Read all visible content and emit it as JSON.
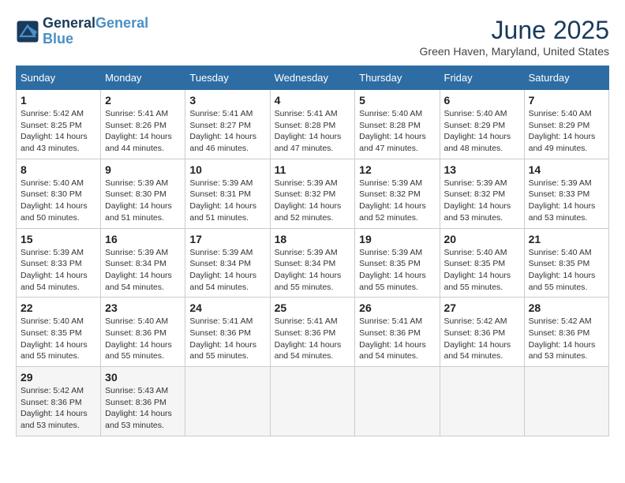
{
  "header": {
    "logo_line1": "General",
    "logo_line2": "Blue",
    "month_year": "June 2025",
    "location": "Green Haven, Maryland, United States"
  },
  "weekdays": [
    "Sunday",
    "Monday",
    "Tuesday",
    "Wednesday",
    "Thursday",
    "Friday",
    "Saturday"
  ],
  "weeks": [
    [
      {
        "day": "1",
        "sunrise": "5:42 AM",
        "sunset": "8:25 PM",
        "daylight": "14 hours and 43 minutes."
      },
      {
        "day": "2",
        "sunrise": "5:41 AM",
        "sunset": "8:26 PM",
        "daylight": "14 hours and 44 minutes."
      },
      {
        "day": "3",
        "sunrise": "5:41 AM",
        "sunset": "8:27 PM",
        "daylight": "14 hours and 46 minutes."
      },
      {
        "day": "4",
        "sunrise": "5:41 AM",
        "sunset": "8:28 PM",
        "daylight": "14 hours and 47 minutes."
      },
      {
        "day": "5",
        "sunrise": "5:40 AM",
        "sunset": "8:28 PM",
        "daylight": "14 hours and 47 minutes."
      },
      {
        "day": "6",
        "sunrise": "5:40 AM",
        "sunset": "8:29 PM",
        "daylight": "14 hours and 48 minutes."
      },
      {
        "day": "7",
        "sunrise": "5:40 AM",
        "sunset": "8:29 PM",
        "daylight": "14 hours and 49 minutes."
      }
    ],
    [
      {
        "day": "8",
        "sunrise": "5:40 AM",
        "sunset": "8:30 PM",
        "daylight": "14 hours and 50 minutes."
      },
      {
        "day": "9",
        "sunrise": "5:39 AM",
        "sunset": "8:30 PM",
        "daylight": "14 hours and 51 minutes."
      },
      {
        "day": "10",
        "sunrise": "5:39 AM",
        "sunset": "8:31 PM",
        "daylight": "14 hours and 51 minutes."
      },
      {
        "day": "11",
        "sunrise": "5:39 AM",
        "sunset": "8:32 PM",
        "daylight": "14 hours and 52 minutes."
      },
      {
        "day": "12",
        "sunrise": "5:39 AM",
        "sunset": "8:32 PM",
        "daylight": "14 hours and 52 minutes."
      },
      {
        "day": "13",
        "sunrise": "5:39 AM",
        "sunset": "8:32 PM",
        "daylight": "14 hours and 53 minutes."
      },
      {
        "day": "14",
        "sunrise": "5:39 AM",
        "sunset": "8:33 PM",
        "daylight": "14 hours and 53 minutes."
      }
    ],
    [
      {
        "day": "15",
        "sunrise": "5:39 AM",
        "sunset": "8:33 PM",
        "daylight": "14 hours and 54 minutes."
      },
      {
        "day": "16",
        "sunrise": "5:39 AM",
        "sunset": "8:34 PM",
        "daylight": "14 hours and 54 minutes."
      },
      {
        "day": "17",
        "sunrise": "5:39 AM",
        "sunset": "8:34 PM",
        "daylight": "14 hours and 54 minutes."
      },
      {
        "day": "18",
        "sunrise": "5:39 AM",
        "sunset": "8:34 PM",
        "daylight": "14 hours and 55 minutes."
      },
      {
        "day": "19",
        "sunrise": "5:39 AM",
        "sunset": "8:35 PM",
        "daylight": "14 hours and 55 minutes."
      },
      {
        "day": "20",
        "sunrise": "5:40 AM",
        "sunset": "8:35 PM",
        "daylight": "14 hours and 55 minutes."
      },
      {
        "day": "21",
        "sunrise": "5:40 AM",
        "sunset": "8:35 PM",
        "daylight": "14 hours and 55 minutes."
      }
    ],
    [
      {
        "day": "22",
        "sunrise": "5:40 AM",
        "sunset": "8:35 PM",
        "daylight": "14 hours and 55 minutes."
      },
      {
        "day": "23",
        "sunrise": "5:40 AM",
        "sunset": "8:36 PM",
        "daylight": "14 hours and 55 minutes."
      },
      {
        "day": "24",
        "sunrise": "5:41 AM",
        "sunset": "8:36 PM",
        "daylight": "14 hours and 55 minutes."
      },
      {
        "day": "25",
        "sunrise": "5:41 AM",
        "sunset": "8:36 PM",
        "daylight": "14 hours and 54 minutes."
      },
      {
        "day": "26",
        "sunrise": "5:41 AM",
        "sunset": "8:36 PM",
        "daylight": "14 hours and 54 minutes."
      },
      {
        "day": "27",
        "sunrise": "5:42 AM",
        "sunset": "8:36 PM",
        "daylight": "14 hours and 54 minutes."
      },
      {
        "day": "28",
        "sunrise": "5:42 AM",
        "sunset": "8:36 PM",
        "daylight": "14 hours and 53 minutes."
      }
    ],
    [
      {
        "day": "29",
        "sunrise": "5:42 AM",
        "sunset": "8:36 PM",
        "daylight": "14 hours and 53 minutes."
      },
      {
        "day": "30",
        "sunrise": "5:43 AM",
        "sunset": "8:36 PM",
        "daylight": "14 hours and 53 minutes."
      },
      null,
      null,
      null,
      null,
      null
    ]
  ],
  "labels": {
    "sunrise": "Sunrise:",
    "sunset": "Sunset:",
    "daylight": "Daylight:"
  }
}
